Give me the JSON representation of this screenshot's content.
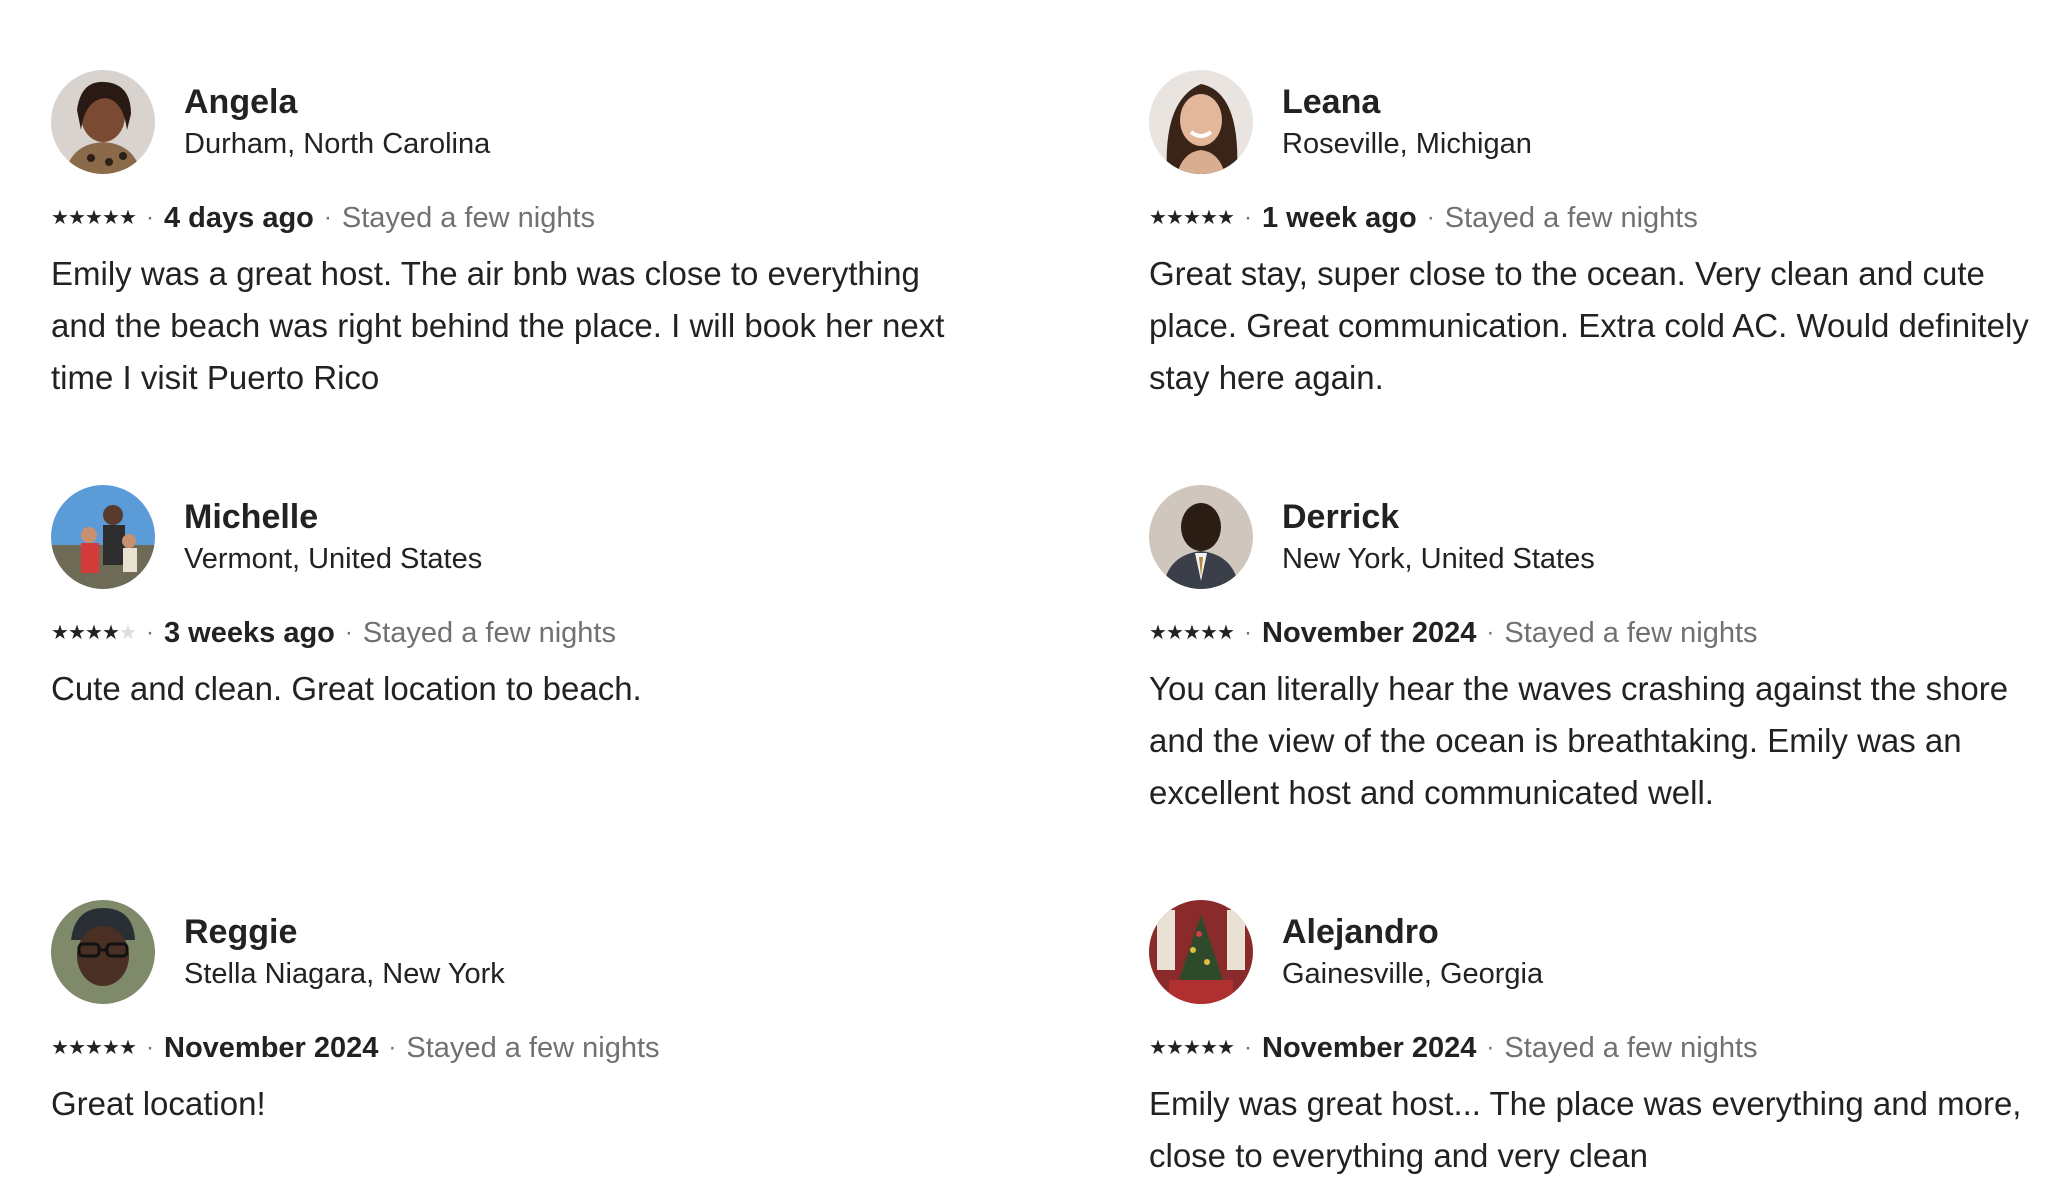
{
  "reviews": [
    {
      "name": "Angela",
      "location": "Durham, North Carolina",
      "rating": 5,
      "when": "4 days ago",
      "stay": "Stayed a few nights",
      "text": "Emily was a great host. The air bnb was close to everything and the beach was right behind the place. I will book her next time I visit Puerto Rico"
    },
    {
      "name": "Leana",
      "location": "Roseville, Michigan",
      "rating": 5,
      "when": "1 week ago",
      "stay": "Stayed a few nights",
      "text": "Great stay, super close to the ocean. Very clean and cute place. Great communication. Extra cold AC. Would definitely stay here again."
    },
    {
      "name": "Michelle",
      "location": "Vermont, United States",
      "rating": 4,
      "when": "3 weeks ago",
      "stay": "Stayed a few nights",
      "text": "Cute and clean. Great location to beach."
    },
    {
      "name": "Derrick",
      "location": "New York, United States",
      "rating": 5,
      "when": "November 2024",
      "stay": "Stayed a few nights",
      "text": "You can literally hear the waves crashing against the shore and the view of the ocean is breathtaking. Emily was an excellent host and communicated well."
    },
    {
      "name": "Reggie",
      "location": "Stella Niagara, New York",
      "rating": 5,
      "when": "November 2024",
      "stay": "Stayed a few nights",
      "text": "Great location!"
    },
    {
      "name": "Alejandro",
      "location": "Gainesville, Georgia",
      "rating": 5,
      "when": "November 2024",
      "stay": "Stayed a few nights",
      "text": "Emily was great host... The place was everything and more, close to everything and very clean"
    }
  ],
  "separator": "·",
  "star_glyph": "★",
  "colors": {
    "text_primary": "#222222",
    "text_secondary": "#717171",
    "star_filled": "#222222",
    "star_empty": "#dddddd"
  }
}
